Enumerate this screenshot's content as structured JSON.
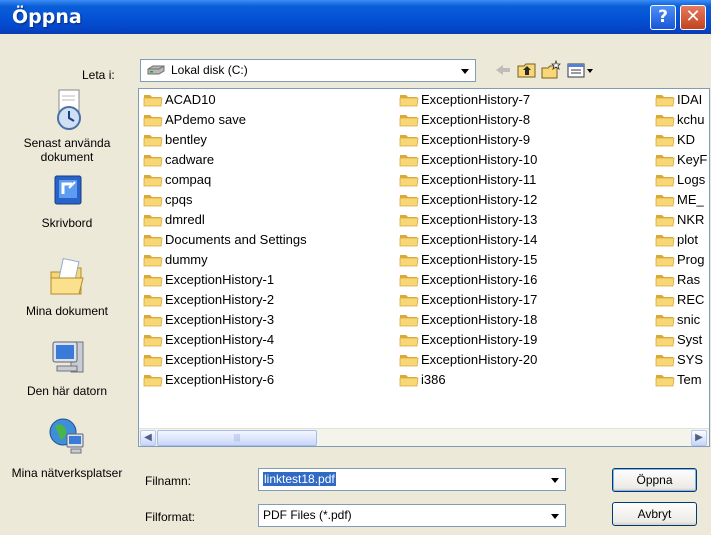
{
  "window": {
    "title": "Öppna"
  },
  "lookin": {
    "label": "Leta i:",
    "value": "Lokal disk (C:)"
  },
  "places": [
    {
      "label": "Senast använda dokument",
      "icon": "recent-documents-icon"
    },
    {
      "label": "Skrivbord",
      "icon": "desktop-icon"
    },
    {
      "label": "Mina dokument",
      "icon": "my-documents-icon"
    },
    {
      "label": "Den här datorn",
      "icon": "my-computer-icon"
    },
    {
      "label": "Mina nätverksplatser",
      "icon": "network-places-icon"
    }
  ],
  "files": {
    "col1": [
      "ACAD10",
      "APdemo save",
      "bentley",
      "cadware",
      "compaq",
      "cpqs",
      "dmredl",
      "Documents and Settings",
      "dummy",
      "ExceptionHistory-1",
      "ExceptionHistory-2",
      "ExceptionHistory-3",
      "ExceptionHistory-4",
      "ExceptionHistory-5",
      "ExceptionHistory-6"
    ],
    "col2": [
      "ExceptionHistory-7",
      "ExceptionHistory-8",
      "ExceptionHistory-9",
      "ExceptionHistory-10",
      "ExceptionHistory-11",
      "ExceptionHistory-12",
      "ExceptionHistory-13",
      "ExceptionHistory-14",
      "ExceptionHistory-15",
      "ExceptionHistory-16",
      "ExceptionHistory-17",
      "ExceptionHistory-18",
      "ExceptionHistory-19",
      "ExceptionHistory-20",
      "i386"
    ],
    "col3": [
      "IDAI",
      "kchu",
      "KD",
      "KeyF",
      "Logs",
      "ME_",
      "NKR",
      "plot",
      "Prog",
      "Ras",
      "REC",
      "snic",
      "Syst",
      "SYS",
      "Tem"
    ]
  },
  "filename": {
    "label": "Filnamn:",
    "value": "linktest18.pdf"
  },
  "filetype": {
    "label": "Filformat:",
    "value": "PDF Files (*.pdf)"
  },
  "buttons": {
    "open": "Öppna",
    "cancel": "Avbryt"
  },
  "colors": {
    "folder": "#f7d776",
    "folder_dark": "#d9a93a",
    "titlebar": "#0453d6",
    "selection": "#316ac5"
  }
}
